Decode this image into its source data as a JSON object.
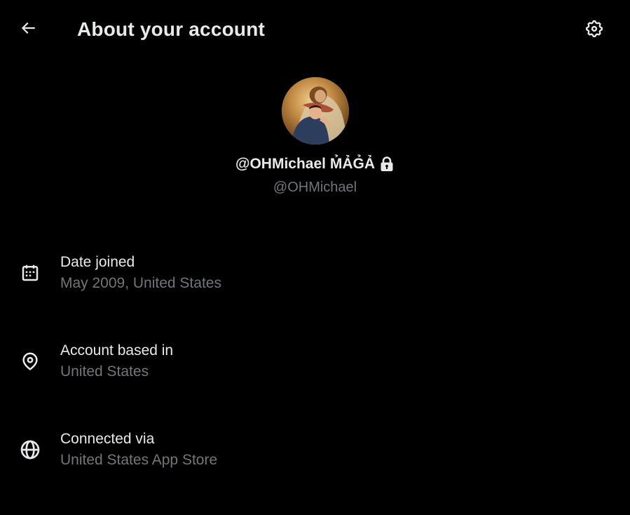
{
  "header": {
    "title": "About your account",
    "back_icon": "arrow-left-icon",
    "settings_icon": "gear-icon"
  },
  "profile": {
    "avatar_icon": "profile-avatar",
    "display_name": "@OHMichael M̉ẢG̉Ả",
    "protected_icon": "lock-icon",
    "handle": "@OHMichael"
  },
  "info": [
    {
      "icon": "calendar-icon",
      "label": "Date joined",
      "value": "May 2009, United States"
    },
    {
      "icon": "location-pin-icon",
      "label": "Account based in",
      "value": "United States"
    },
    {
      "icon": "globe-icon",
      "label": "Connected via",
      "value": "United States App Store"
    }
  ],
  "colors": {
    "background": "#000000",
    "primary_text": "#e7e9ea",
    "secondary_text": "#71767b"
  }
}
